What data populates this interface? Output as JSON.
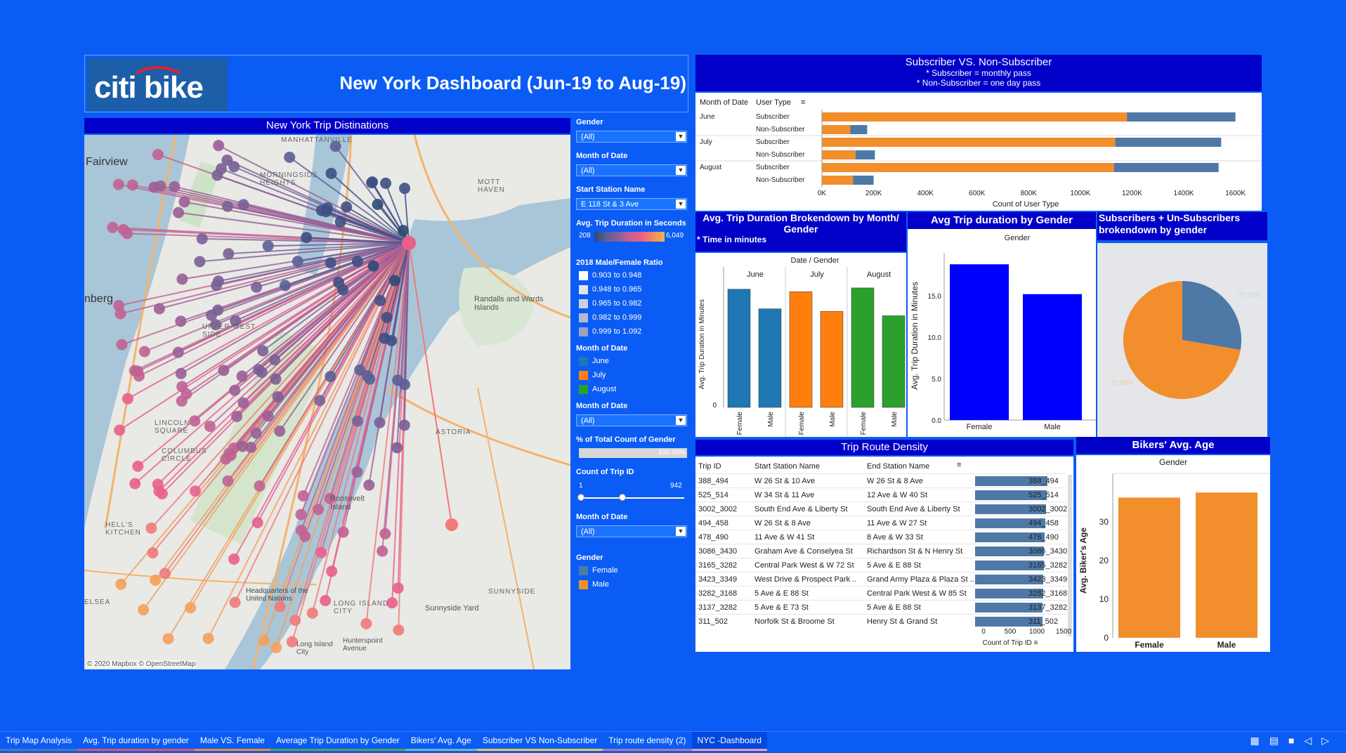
{
  "header": {
    "logo": "citi bike",
    "title": "New York Dashboard (Jun-19 to  Aug-19)"
  },
  "map": {
    "title": "New York Trip Distinations",
    "credit": "© 2020 Mapbox © OpenStreetMap",
    "place_labels": [
      "Fairview",
      "MANHATTANVILLE",
      "MORNINGSIDE HEIGHTS",
      "MOTT HAVEN",
      "Randalls and Wards Islands",
      "UPPER WEST SIDE",
      "LINCOLN SQUARE",
      "COLUMBUS CIRCLE",
      "HELL'S KITCHEN",
      "ASTORIA",
      "Roosevelt Island",
      "SUNNYSIDE",
      "LONG ISLAND CITY",
      "Sunnyside Yard",
      "Long Island City",
      "Hunterspoint Avenue",
      "nberg",
      "ELSEA",
      "Headquarters of the United Nations"
    ]
  },
  "filters": {
    "gender_label": "Gender",
    "gender_value": "(All)",
    "month1_label": "Month of Date",
    "month1_value": "(All)",
    "start_station_label": "Start Station Name",
    "start_station_value": "E 118 St & 3 Ave",
    "avg_trip_label": "Avg. Trip Duration in Seconds",
    "avg_trip_min": "208",
    "avg_trip_max": "6,049",
    "ratio_label": "2018 Male/Female Ratio",
    "ratio_items": [
      "0.903 to 0.948",
      "0.948 to 0.965",
      "0.965 to 0.982",
      "0.982 to 0.999",
      "0.999 to 1.092"
    ],
    "ratio_colors": [
      "#ffffff",
      "#e4e4ee",
      "#cfd0e2",
      "#b6b7d4",
      "#9d9fc6"
    ],
    "month_legend_label": "Month of Date",
    "month_legend": [
      "June",
      "July",
      "August"
    ],
    "month_colors": [
      "#1f77b4",
      "#ff7f0e",
      "#2ca02c"
    ],
    "month2_label": "Month of Date",
    "month2_value": "(All)",
    "pct_label": "% of Total Count of Gender",
    "pct_value": "100.00%",
    "count_label": "Count of Trip ID",
    "count_min": "1",
    "count_max": "942",
    "month3_label": "Month of Date",
    "month3_value": "(All)",
    "gender_legend_label": "Gender",
    "gender_legend": [
      "Female",
      "Male"
    ],
    "gender_colors": [
      "#4e79a7",
      "#f28e2b"
    ]
  },
  "subscriber": {
    "title": "Subscriber  VS. Non-Subscriber",
    "note1": "* Subscriber = monthly pass",
    "note2": "* Non-Subscriber = one day pass",
    "col1": "Month of Date",
    "col2": "User Type",
    "months": [
      "June",
      "July",
      "August"
    ],
    "types": [
      "Subscriber",
      "Non-Subscriber"
    ],
    "axis_title": "Count of User Type",
    "ticks": [
      "0K",
      "200K",
      "400K",
      "600K",
      "800K",
      "1000K",
      "1200K",
      "1400K",
      "1600K"
    ],
    "colors": {
      "female": "#4e79a7",
      "male": "#f28e2b"
    }
  },
  "month_gender": {
    "title": "Avg. Trip Duration Brokendown by Month/ Gender",
    "note": "* Time in minutes",
    "header": "Date  /  Gender",
    "months": [
      "June",
      "July",
      "August"
    ],
    "genders": [
      "Female",
      "Male"
    ],
    "ylabel": "Avg. Trip Duration in Minutes"
  },
  "gender_avg": {
    "title": "Avg Trip duration by Gender",
    "header": "Gender",
    "ylabel": "Avg. Trip Duration in Minutes",
    "categories": [
      "Female",
      "Male"
    ],
    "ticks": [
      "0.0",
      "5.0",
      "10.0",
      "15.0"
    ]
  },
  "pie": {
    "title": "Subscribers + Un-Subscribers brokendown by gender",
    "labels": [
      "27.70%",
      "72.30%"
    ]
  },
  "route": {
    "title": "Trip Route Density",
    "columns": [
      "Trip ID",
      "Start Station Name",
      "End Station Name"
    ],
    "rows": [
      [
        "388_494",
        "W 26 St & 10 Ave",
        "W 26 St & 8 Ave",
        "388_494"
      ],
      [
        "525_514",
        "W 34 St & 11 Ave",
        "12 Ave & W 40 St",
        "525_514"
      ],
      [
        "3002_3002",
        "South End Ave & Liberty St",
        "South End Ave & Liberty St",
        "3002_3002"
      ],
      [
        "494_458",
        "W 26 St & 8 Ave",
        "11 Ave & W 27 St",
        "494_458"
      ],
      [
        "478_490",
        "11 Ave & W 41 St",
        "8 Ave & W 33 St",
        "478_490"
      ],
      [
        "3086_3430",
        "Graham Ave & Conselyea St",
        "Richardson St & N Henry St",
        "3086_3430"
      ],
      [
        "3165_3282",
        "Central Park West & W 72 St",
        "5 Ave & E 88 St",
        "3165_3282"
      ],
      [
        "3423_3349",
        "West Drive & Prospect Park ..",
        "Grand Army Plaza & Plaza St ..",
        "3423_3349"
      ],
      [
        "3282_3168",
        "5 Ave & E 88 St",
        "Central Park West & W 85 St",
        "3282_3168"
      ],
      [
        "3137_3282",
        "5 Ave & E 73 St",
        "5 Ave & E 88 St",
        "3137_3282"
      ],
      [
        "311_502",
        "Norfolk St & Broome St",
        "Henry St & Grand St",
        "311_502"
      ]
    ],
    "axis_title": "Count of Trip ID",
    "ticks": [
      "0",
      "500",
      "1000",
      "1500"
    ]
  },
  "age": {
    "title": "Bikers' Avg. Age",
    "header": "Gender",
    "ylabel": "Avg. Biker's Age",
    "categories": [
      "Female",
      "Male"
    ],
    "ticks": [
      "0",
      "10",
      "20",
      "30"
    ]
  },
  "chart_data": [
    {
      "type": "bar",
      "title": "Subscriber  VS. Non-Subscriber",
      "xlabel": "Count of User Type",
      "categories": [
        "June Subscriber",
        "June Non-Subscriber",
        "July Subscriber",
        "July Non-Subscriber",
        "August Subscriber",
        "August Non-Subscriber"
      ],
      "series": [
        {
          "name": "Male",
          "values": [
            1180000,
            110000,
            1135000,
            130000,
            1130000,
            120000
          ]
        },
        {
          "name": "Female",
          "values": [
            420000,
            65000,
            410000,
            75000,
            405000,
            80000
          ]
        }
      ],
      "xlim": [
        0,
        1680000
      ]
    },
    {
      "type": "bar",
      "title": "Avg. Trip Duration Brokendown by Month/ Gender",
      "ylabel": "Avg. Trip Duration in Minutes",
      "categories": [
        "June Female",
        "June Male",
        "July Female",
        "July Male",
        "August Female",
        "August Male"
      ],
      "values": [
        18.7,
        15.6,
        18.3,
        15.2,
        18.9,
        14.5
      ],
      "ylim": [
        0,
        20
      ]
    },
    {
      "type": "bar",
      "title": "Avg Trip duration by Gender",
      "ylabel": "Avg. Trip Duration in Minutes",
      "categories": [
        "Female",
        "Male"
      ],
      "values": [
        18.8,
        15.2
      ],
      "ylim": [
        0,
        19.5
      ]
    },
    {
      "type": "pie",
      "title": "Subscribers + Un-Subscribers brokendown by gender",
      "categories": [
        "Female",
        "Male"
      ],
      "values": [
        27.7,
        72.3
      ]
    },
    {
      "type": "bar",
      "title": "Trip Route Density",
      "xlabel": "Count of Trip ID",
      "categories": [
        "388_494",
        "525_514",
        "3002_3002",
        "494_458",
        "478_490",
        "3086_3430",
        "3165_3282",
        "3423_3349",
        "3282_3168",
        "3137_3282",
        "311_502"
      ],
      "values": [
        940,
        930,
        920,
        915,
        905,
        900,
        895,
        890,
        885,
        880,
        875
      ],
      "xlim": [
        0,
        1700
      ]
    },
    {
      "type": "bar",
      "title": "Bikers' Avg. Age",
      "ylabel": "Avg. Biker's Age",
      "categories": [
        "Female",
        "Male"
      ],
      "values": [
        36.3,
        37.6
      ],
      "ylim": [
        0,
        40
      ]
    }
  ],
  "tabs": [
    "Trip Map Analysis",
    "Avg. Trip duration by gender",
    "Male VS. Female",
    "Average Trip Duration by Gender",
    "Bikers' Avg. Age",
    "Subscriber VS Non-Subscriber",
    "Trip route density (2)",
    "NYC -Dashboard"
  ],
  "tab_colors": [
    "#4e79a7",
    "#e15759",
    "#f28e2b",
    "#59a14f",
    "#76b7b2",
    "#edc948",
    "#b07aa1",
    "#ff9da7"
  ]
}
